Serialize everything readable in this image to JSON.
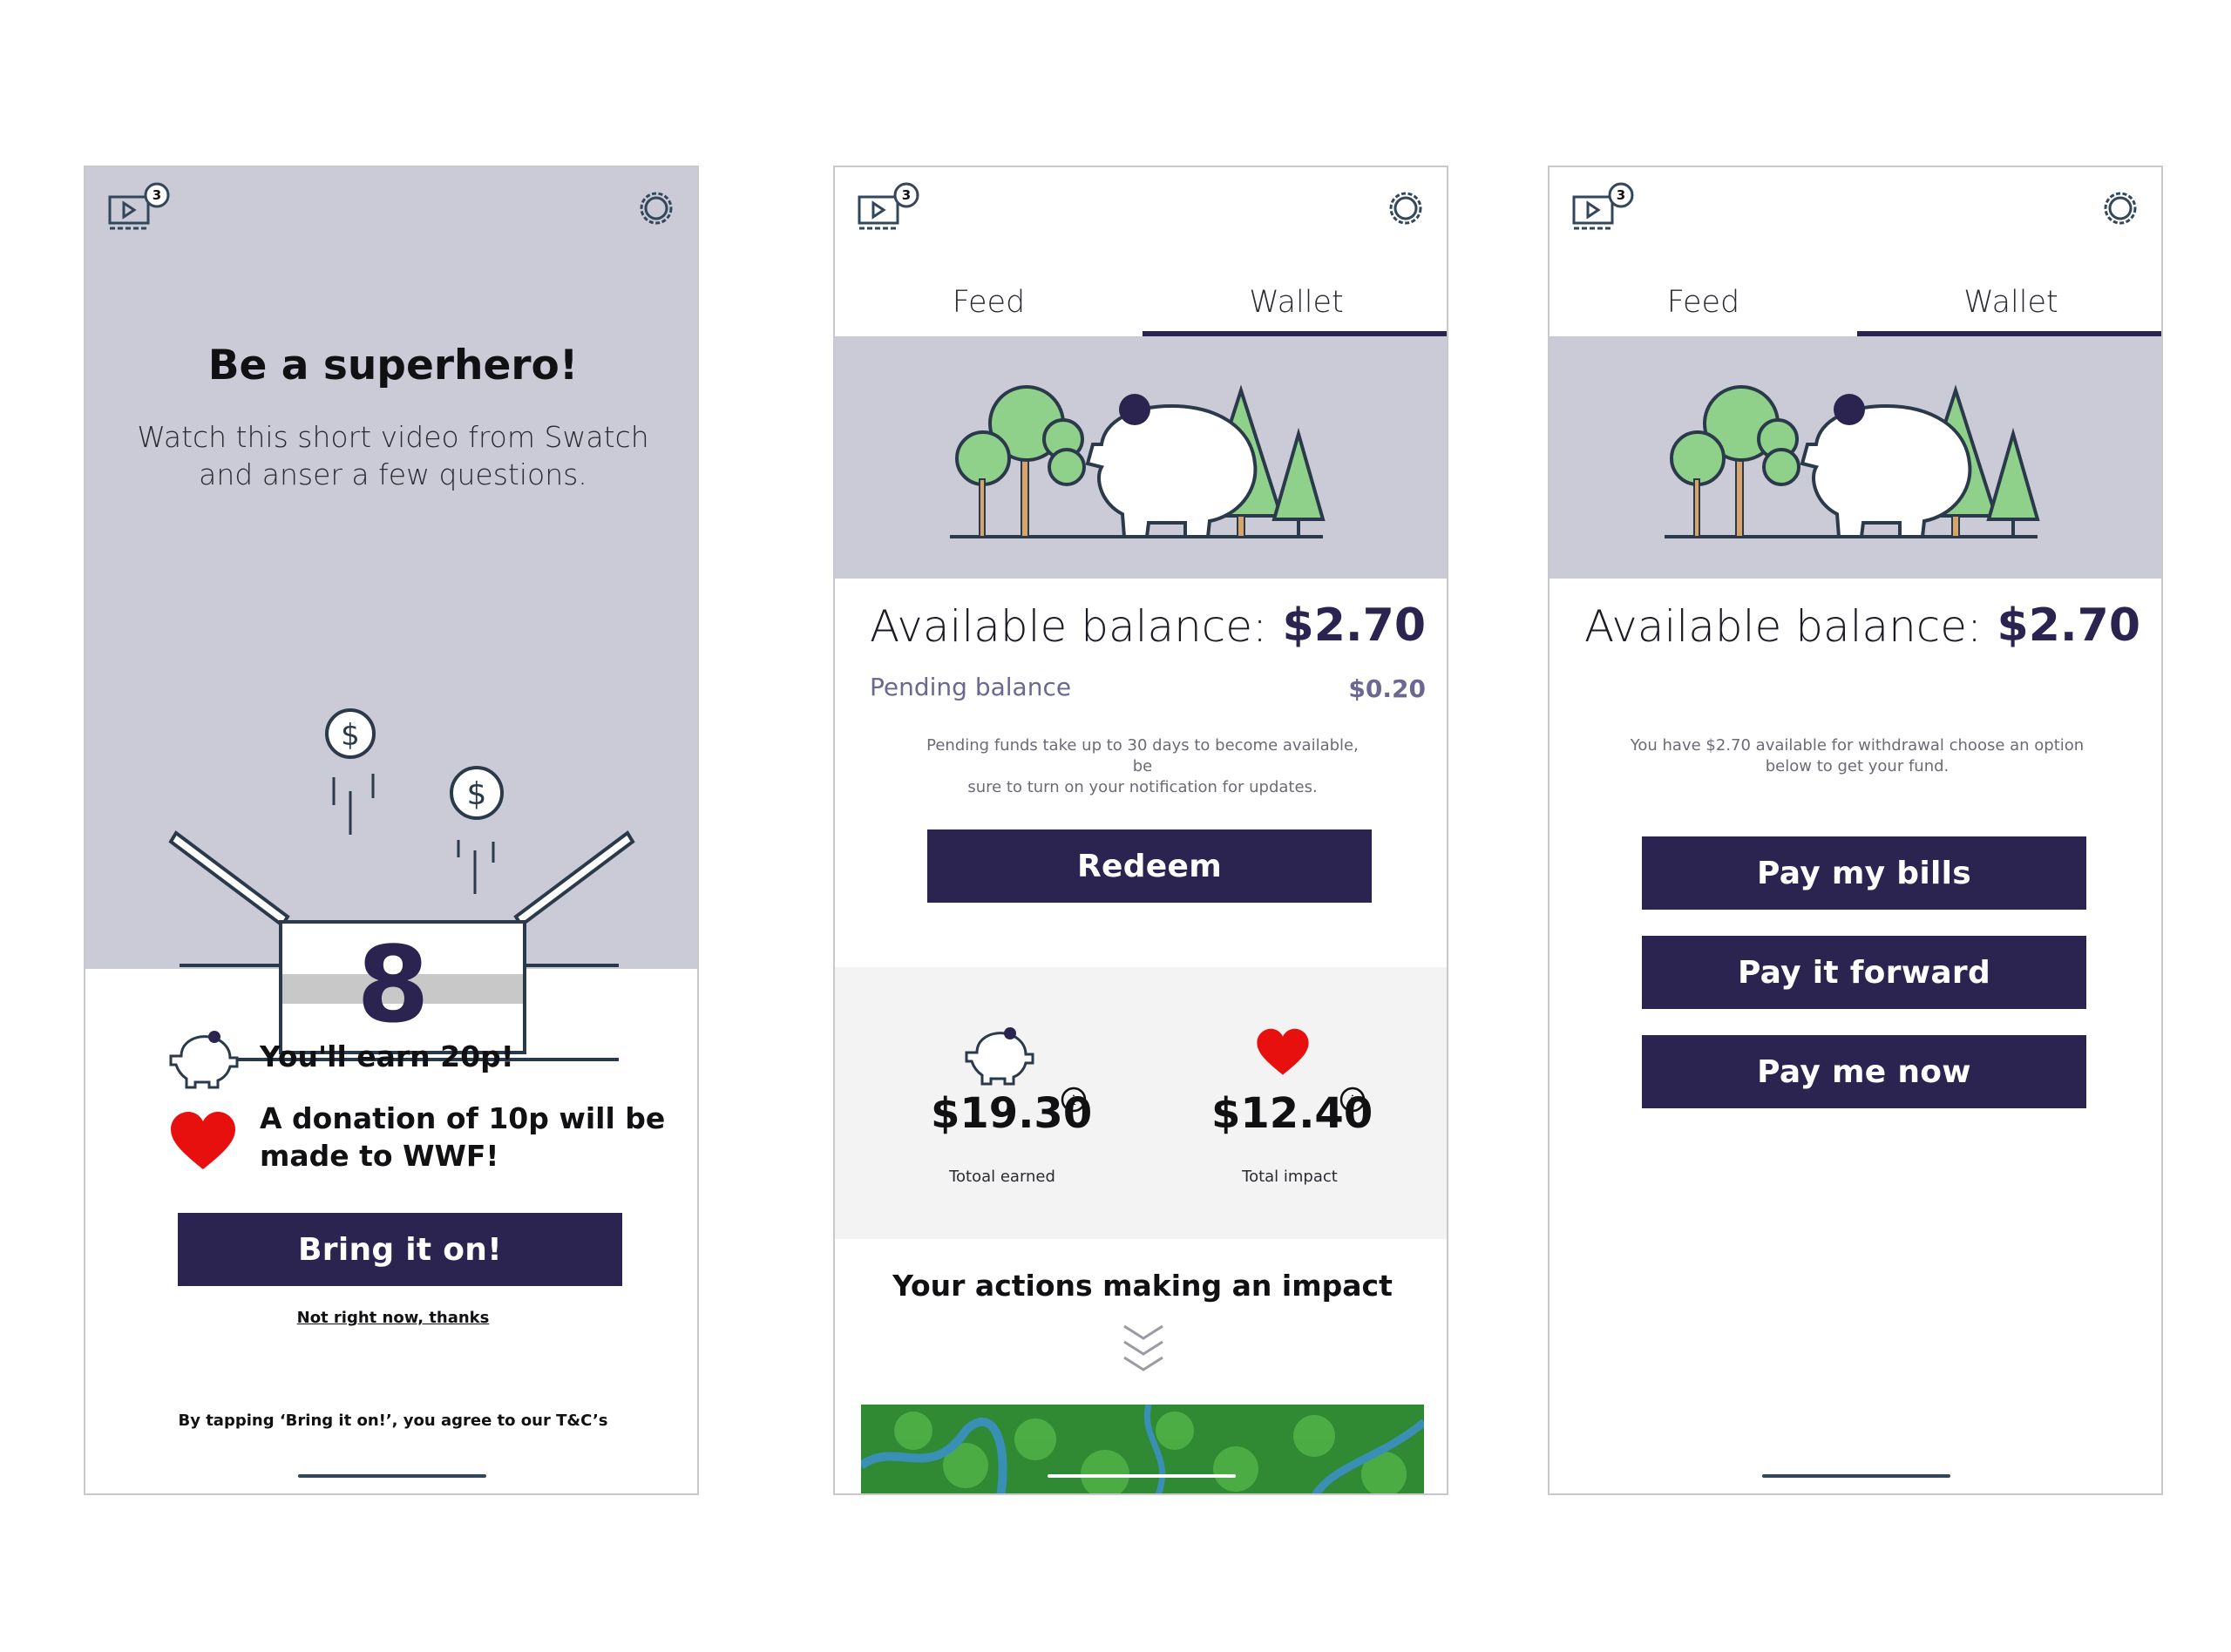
{
  "screen1": {
    "notification_count": "3",
    "title": "Be a superhero!",
    "subtitle_line1": "Watch this short video from Swatch",
    "subtitle_line2": "and anser a few questions.",
    "box_number": "8",
    "earn_text": "You'll earn 20p!",
    "donation_line1": "A donation of 10p will be",
    "donation_line2": "made to WWF!",
    "cta_label": "Bring it on!",
    "decline_label": "Not right now, thanks",
    "terms": "By tapping ‘Bring it on!’, you agree to our T&C’s"
  },
  "screen2": {
    "notification_count": "3",
    "tabs": [
      {
        "label": "Feed"
      },
      {
        "label": "Wallet"
      }
    ],
    "active_tab": "Wallet",
    "balance_label": "Available balance:",
    "balance_value": "$2.70",
    "pending_label": "Pending balance",
    "pending_value": "$0.20",
    "note_line1": "Pending funds take up to 30 days to become available, be",
    "note_line2": "sure to turn on your notification for updates.",
    "redeem_label": "Redeem",
    "earned_value": "$19.30",
    "earned_label": "Totoal earned",
    "impact_value": "$12.40",
    "impact_label": "Total impact",
    "impact_title": "Your actions making an impact"
  },
  "screen3": {
    "notification_count": "3",
    "tabs": [
      {
        "label": "Feed"
      },
      {
        "label": "Wallet"
      }
    ],
    "active_tab": "Wallet",
    "balance_label": "Available balance:",
    "balance_value": "$2.70",
    "note_line1": "You have $2.70 available for withdrawal choose an option",
    "note_line2": "below to get your fund.",
    "buttons": [
      {
        "label": "Pay my bills"
      },
      {
        "label": "Pay it forward"
      },
      {
        "label": "Pay me now"
      }
    ]
  },
  "colors": {
    "brand_navy": "#2b2450",
    "lavender": "#cbcad7",
    "heart_red": "#e8100f",
    "tree_green": "#8fd18a"
  }
}
